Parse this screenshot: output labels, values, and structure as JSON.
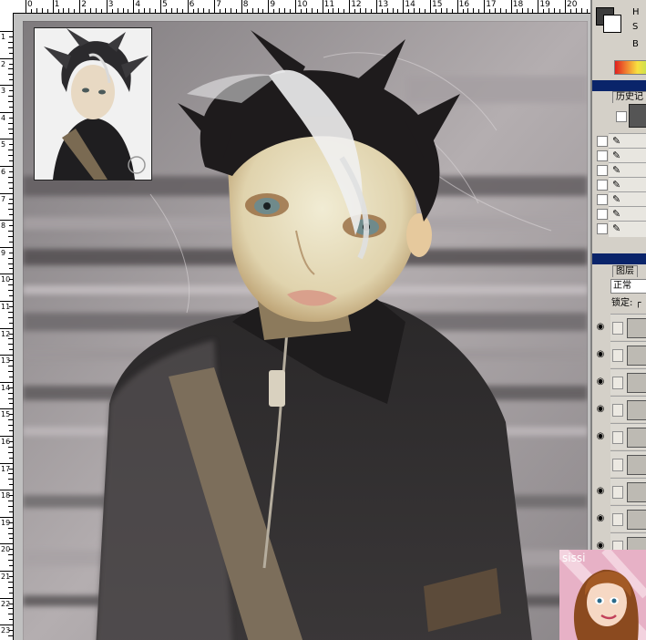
{
  "ruler": {
    "top_ticks": [
      "0",
      "1",
      "2",
      "3",
      "4",
      "5",
      "6",
      "7",
      "8",
      "9",
      "10",
      "11",
      "12",
      "13",
      "14",
      "15",
      "16",
      "17",
      "18",
      "19",
      "20"
    ],
    "left_ticks": [
      "1",
      "2",
      "3",
      "4",
      "5",
      "6",
      "7",
      "8",
      "9",
      "10",
      "11",
      "12",
      "13",
      "14",
      "15",
      "16",
      "17",
      "18",
      "19",
      "20",
      "21",
      "22",
      "23"
    ]
  },
  "document": {
    "painting_subject": "painted portrait of a doll boy with spiky hair and black jacket"
  },
  "history_panel": {
    "tab_label": "历史记"
  },
  "layers_panel": {
    "tab_label": "图层",
    "blend_mode": "正常",
    "lock_label": "锁定: ┌"
  },
  "tool_swatch": {
    "label_h": "H",
    "label_s": "S",
    "label_b": "B"
  },
  "badge": {
    "name": "sissi"
  },
  "colors": {
    "panel_bg": "#d4d0c8",
    "title_blue": "#0a246a",
    "canvas_bg": "#8a8686"
  }
}
